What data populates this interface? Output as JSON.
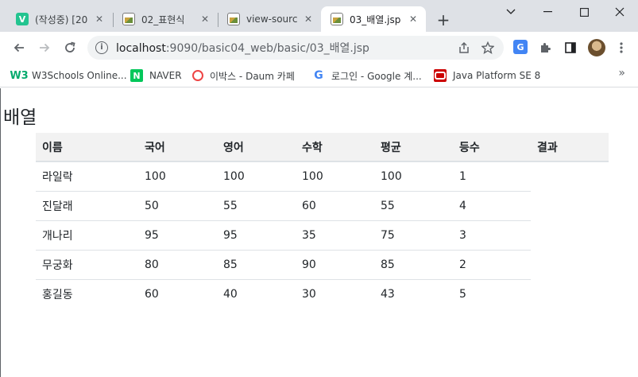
{
  "tabs": [
    {
      "label": "(작성중) [20",
      "favicon": "V"
    },
    {
      "label": "02_표현식"
    },
    {
      "label": "view-source"
    },
    {
      "label": "03_배열.jsp",
      "active": true
    }
  ],
  "new_tab_label": "+",
  "toolbar": {
    "url_host": "localhost",
    "url_rest": ":9090/basic04_web/basic/03_배열.jsp"
  },
  "bookmarks": [
    {
      "label": "W3Schools Online...",
      "favicon": "W3"
    },
    {
      "label": "NAVER",
      "favicon": "N"
    },
    {
      "label": "이박스 - Daum 카페"
    },
    {
      "label": "로그인 - Google 계...",
      "favicon": "G"
    },
    {
      "label": "Java Platform SE 8"
    }
  ],
  "page": {
    "title": "배열",
    "table": {
      "headers": [
        "이름",
        "국어",
        "영어",
        "수학",
        "평균",
        "등수",
        "결과"
      ],
      "rows": [
        [
          "라일락",
          "100",
          "100",
          "100",
          "100",
          "1"
        ],
        [
          "진달래",
          "50",
          "55",
          "60",
          "55",
          "4"
        ],
        [
          "개나리",
          "95",
          "95",
          "35",
          "75",
          "3"
        ],
        [
          "무궁화",
          "80",
          "85",
          "90",
          "85",
          "2"
        ],
        [
          "홍길동",
          "60",
          "40",
          "30",
          "43",
          "5"
        ]
      ]
    }
  },
  "colors": {
    "tabstrip": "#dee1e6",
    "header_row": "#f2f2f2",
    "row_border": "#dee2e6"
  }
}
